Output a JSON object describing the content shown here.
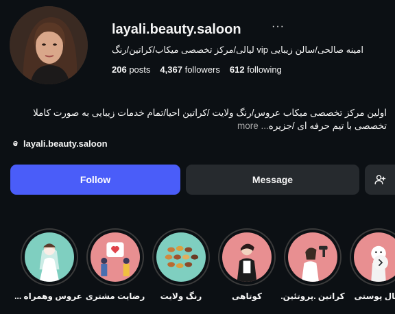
{
  "profile": {
    "username": "layali.beauty.saloon",
    "more_icon": "ellipsis-icon",
    "full_name": "امینه صالحی/سالن زیبایی vip لیالی/مرکز تخصصی میکاب/کراتین/رنگ",
    "stats": {
      "posts_count": "206",
      "posts_label": "posts",
      "followers_count": "4,367",
      "followers_label": "followers",
      "following_count": "612",
      "following_label": "following"
    },
    "bio_line1": "اولین مرکز تخصصی میکاب عروس/رنگ ولایت /کراتین احیا/تمام خدمات زیبایی به صورت کاملا",
    "bio_line2": "تخصصی با تیم حرفه ای /جزیره",
    "bio_more": "... more",
    "threads_handle": "layali.beauty.saloon",
    "threads_icon": "threads-icon"
  },
  "actions": {
    "follow_label": "Follow",
    "message_label": "Message",
    "add_user_icon": "add-user-icon"
  },
  "highlights": [
    {
      "label": "عروس وهمراه ...",
      "bg": "#7fcfc0"
    },
    {
      "label": "رضایت مشتری",
      "bg": "#e88f91"
    },
    {
      "label": "رنگ ولایت",
      "bg": "#7fcfc0"
    },
    {
      "label": "کوتاهی",
      "bg": "#e88f91"
    },
    {
      "label": "کراتین .پروتئین.",
      "bg": "#e88f91"
    },
    {
      "label": "شال پوستی",
      "bg": "#e88f91"
    }
  ],
  "colors": {
    "background": "#0c1014",
    "follow_button": "#4a5df9",
    "secondary_button": "#262a2e",
    "muted_text": "#a8a8a8"
  }
}
